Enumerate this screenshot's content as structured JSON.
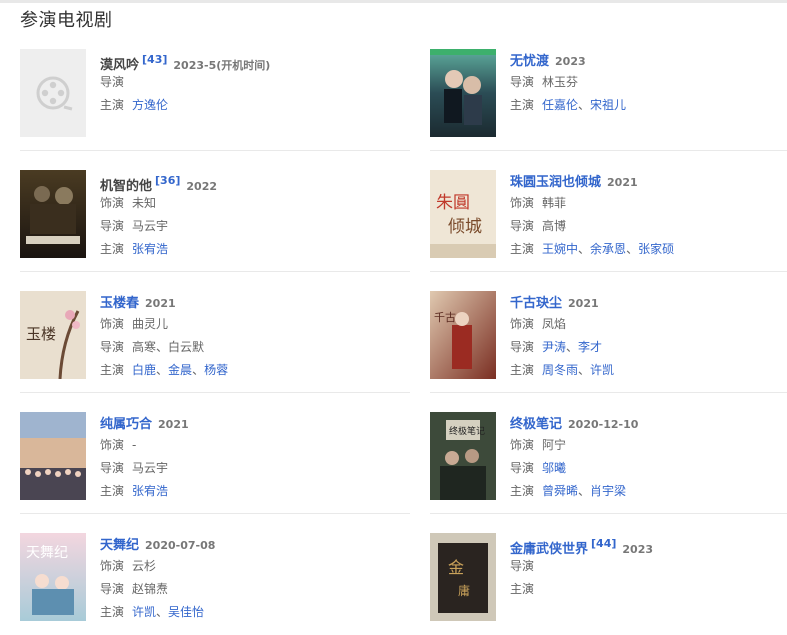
{
  "section_title": "参演电视剧",
  "labels": {
    "role": "饰演",
    "director": "导演",
    "cast": "主演"
  },
  "items": [
    {
      "title": "漠风吟",
      "ref": "[43]",
      "date": "2023-5(开机时间)",
      "role": "",
      "director": [],
      "cast": [
        "方逸伦"
      ],
      "poster": "placeholder",
      "title_link": false
    },
    {
      "title": "无忧渡",
      "ref": "",
      "date": "2023",
      "role": "",
      "director": [
        "林玉芬"
      ],
      "cast": [
        "任嘉伦",
        "宋祖儿"
      ],
      "poster": "dark-teal",
      "title_link": true
    },
    {
      "title": "机智的他",
      "ref": "[36]",
      "date": "2022",
      "role": "未知",
      "director": [
        "马云宇"
      ],
      "cast": [
        "张宥浩"
      ],
      "poster": "dark-brown",
      "title_link": false
    },
    {
      "title": "珠圆玉润也倾城",
      "ref": "",
      "date": "2021",
      "role": "韩菲",
      "director": [
        "高博"
      ],
      "cast": [
        "王婉中",
        "余承恩",
        "张家硕"
      ],
      "poster": "beige-calligraphy",
      "title_link": true
    },
    {
      "title": "玉楼春",
      "ref": "",
      "date": "2021",
      "role": "曲灵儿",
      "director": [
        "高寒",
        "白云默"
      ],
      "cast": [
        "白鹿",
        "金晨",
        "杨蓉"
      ],
      "poster": "beige-tree",
      "title_link": true
    },
    {
      "title": "千古玦尘",
      "ref": "",
      "date": "2021",
      "role": "凤焰",
      "director": [
        "尹涛",
        "李才"
      ],
      "cast": [
        "周冬雨",
        "许凯"
      ],
      "poster": "red-brown",
      "title_link": true
    },
    {
      "title": "纯属巧合",
      "ref": "",
      "date": "2021",
      "role": "-",
      "director": [
        "马云宇"
      ],
      "cast": [
        "张宥浩"
      ],
      "poster": "group-photo",
      "title_link": true
    },
    {
      "title": "终极笔记",
      "ref": "",
      "date": "2020-12-10",
      "role": "阿宁",
      "director": [
        "邬曦"
      ],
      "cast": [
        "曾舜晞",
        "肖宇梁"
      ],
      "poster": "green-group",
      "title_link": true
    },
    {
      "title": "天舞纪",
      "ref": "",
      "date": "2020-07-08",
      "role": "云杉",
      "director": [
        "赵锦焘"
      ],
      "cast": [
        "许凯",
        "吴佳怡"
      ],
      "poster": "pastel",
      "title_link": true
    },
    {
      "title": "金庸武侠世界",
      "ref": "[44]",
      "date": "2023",
      "role": "",
      "director": [],
      "cast": [],
      "poster": "gold-dark",
      "title_link": true
    }
  ],
  "director_plain": [
    "高博",
    "高寒",
    "白云默",
    "马云宇",
    "赵锦焘",
    "林玉芬"
  ],
  "colors": {
    "link": "#3366cc",
    "text": "#666666",
    "divider": "#e9e9e9"
  }
}
